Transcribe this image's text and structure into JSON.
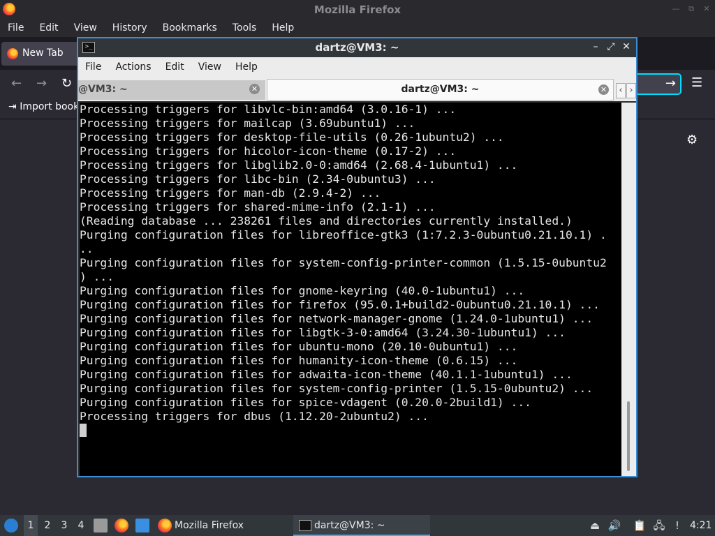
{
  "firefox": {
    "title": "Mozilla Firefox",
    "menu": [
      "File",
      "Edit",
      "View",
      "History",
      "Bookmarks",
      "Tools",
      "Help"
    ],
    "tab_label": "New Tab",
    "import_bookmarks_label": "Import book",
    "url_arrow": "→"
  },
  "terminal": {
    "title": "dartz@VM3: ~",
    "menu": [
      "File",
      "Actions",
      "Edit",
      "View",
      "Help"
    ],
    "tabs": [
      {
        "label": "@VM3: ~"
      },
      {
        "label": "dartz@VM3: ~"
      }
    ],
    "lines": [
      "Processing triggers for libvlc-bin:amd64 (3.0.16-1) ...",
      "Processing triggers for mailcap (3.69ubuntu1) ...",
      "Processing triggers for desktop-file-utils (0.26-1ubuntu2) ...",
      "Processing triggers for hicolor-icon-theme (0.17-2) ...",
      "Processing triggers for libglib2.0-0:amd64 (2.68.4-1ubuntu1) ...",
      "Processing triggers for libc-bin (2.34-0ubuntu3) ...",
      "Processing triggers for man-db (2.9.4-2) ...",
      "Processing triggers for shared-mime-info (2.1-1) ...",
      "(Reading database ... 238261 files and directories currently installed.)",
      "Purging configuration files for libreoffice-gtk3 (1:7.2.3-0ubuntu0.21.10.1) .",
      "..",
      "Purging configuration files for system-config-printer-common (1.5.15-0ubuntu2",
      ") ...",
      "Purging configuration files for gnome-keyring (40.0-1ubuntu1) ...",
      "Purging configuration files for firefox (95.0.1+build2-0ubuntu0.21.10.1) ...",
      "Purging configuration files for network-manager-gnome (1.24.0-1ubuntu1) ...",
      "Purging configuration files for libgtk-3-0:amd64 (3.24.30-1ubuntu1) ...",
      "Purging configuration files for ubuntu-mono (20.10-0ubuntu1) ...",
      "Purging configuration files for humanity-icon-theme (0.6.15) ...",
      "Purging configuration files for adwaita-icon-theme (40.1.1-1ubuntu1) ...",
      "Purging configuration files for system-config-printer (1.5.15-0ubuntu2) ...",
      "Purging configuration files for spice-vdagent (0.20.0-2build1) ...",
      "Processing triggers for dbus (1.12.20-2ubuntu2) ..."
    ]
  },
  "taskbar": {
    "workspaces": [
      "1",
      "2",
      "3",
      "4"
    ],
    "active_workspace": "1",
    "tasks": [
      {
        "label": "Mozilla Firefox",
        "icon": "firefox-icon"
      },
      {
        "label": "dartz@VM3: ~",
        "icon": "terminal-icon"
      }
    ],
    "clock": "4:21"
  }
}
